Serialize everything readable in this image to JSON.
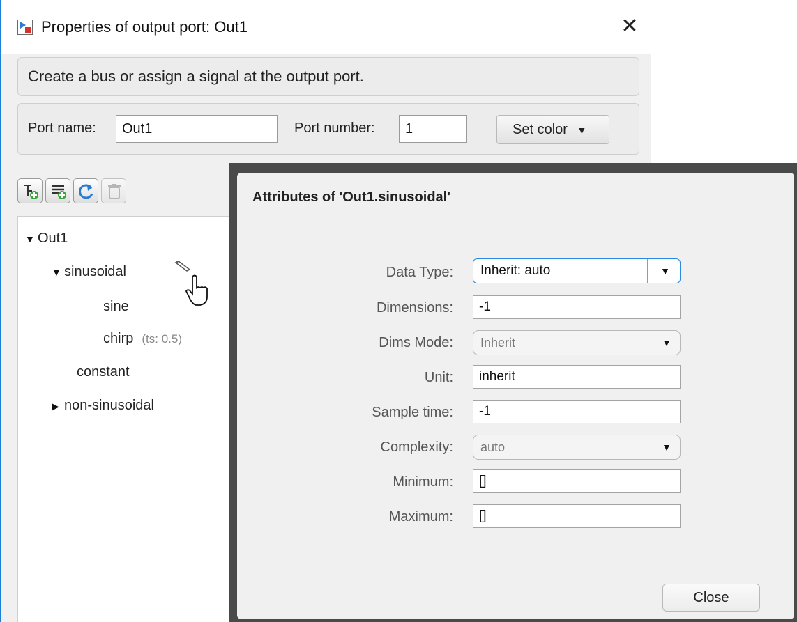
{
  "window": {
    "title": "Properties of output port: Out1"
  },
  "description": "Create a bus or assign a signal at the output port.",
  "port": {
    "name_label": "Port name:",
    "name_value": "Out1",
    "number_label": "Port number:",
    "number_value": "1",
    "set_color_label": "Set color"
  },
  "toolbar": {
    "icons": [
      "add-subsignal-icon",
      "add-signal-icon",
      "refresh-icon",
      "delete-icon"
    ]
  },
  "tree": {
    "root": "Out1",
    "sinusoidal": "sinusoidal",
    "sine": "sine",
    "chirp": "chirp",
    "chirp_ts": "(ts: 0.5)",
    "constant": "constant",
    "non_sinusoidal": "non-sinusoidal"
  },
  "attributes": {
    "title": "Attributes of 'Out1.sinusoidal'",
    "data_type_label": "Data Type:",
    "data_type_value": "Inherit: auto",
    "dimensions_label": "Dimensions:",
    "dimensions_value": "-1",
    "dims_mode_label": "Dims Mode:",
    "dims_mode_value": "Inherit",
    "unit_label": "Unit:",
    "unit_value": "inherit",
    "sample_time_label": "Sample time:",
    "sample_time_value": "-1",
    "complexity_label": "Complexity:",
    "complexity_value": "auto",
    "minimum_label": "Minimum:",
    "minimum_value": "[]",
    "maximum_label": "Maximum:",
    "maximum_value": "[]",
    "close_label": "Close"
  },
  "colors": {
    "accent": "#1c7fd8",
    "close_icon": "#d6322b"
  }
}
